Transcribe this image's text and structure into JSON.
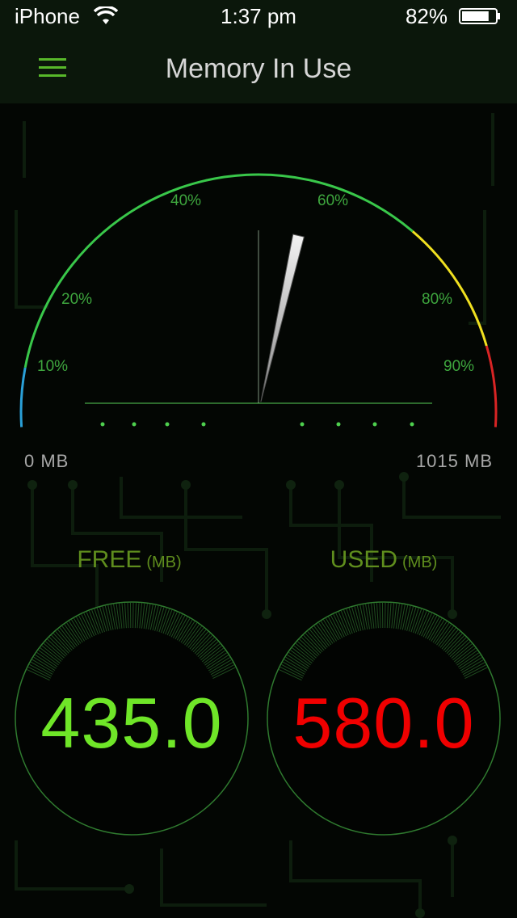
{
  "status_bar": {
    "carrier": "iPhone",
    "time": "1:37 pm",
    "battery_percent": "82%",
    "battery_level": 0.82
  },
  "nav": {
    "title": "Memory In Use",
    "menu_icon": "hamburger-menu-icon"
  },
  "gauge": {
    "tick_labels": [
      "10%",
      "20%",
      "40%",
      "60%",
      "80%",
      "90%"
    ],
    "min_label": "0 MB",
    "max_label": "1015 MB",
    "needle_percent": 57.1,
    "colors": {
      "green": "#39c74a",
      "yellow": "#f0e020",
      "red": "#d82424",
      "blue": "#2aa0d8"
    }
  },
  "free": {
    "label": "FREE",
    "unit": "(MB)",
    "value": "435.0"
  },
  "used": {
    "label": "USED",
    "unit": "(MB)",
    "value": "580.0"
  }
}
